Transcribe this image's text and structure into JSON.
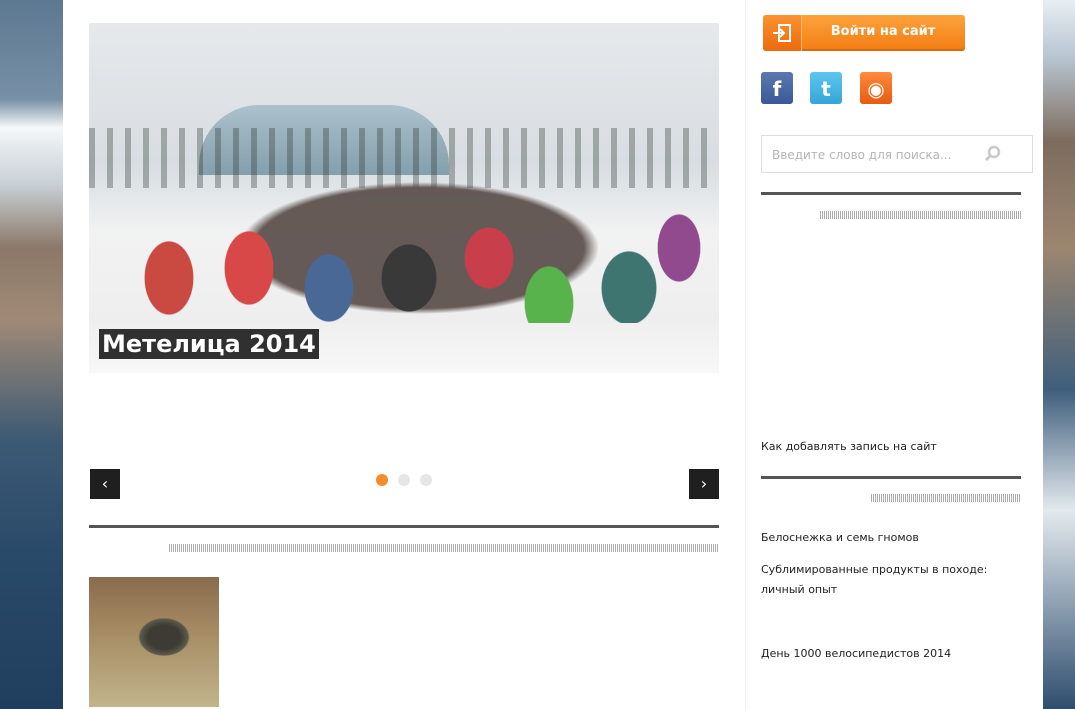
{
  "slider": {
    "caption": "Метелица 2014",
    "prev_symbol": "‹",
    "next_symbol": "›",
    "dots": [
      {
        "active": true
      },
      {
        "active": false
      },
      {
        "active": false
      }
    ]
  },
  "sidebar": {
    "login_label": "Войти на сайт",
    "social": {
      "facebook_glyph": "f",
      "twitter_glyph": "t",
      "rss_glyph": "◉"
    },
    "search": {
      "placeholder": "Введите слово для поиска..."
    },
    "links_group1": [
      "Как добавлять запись на сайт"
    ],
    "links_group2": [
      "Белоснежка и семь гномов",
      "Сублимированные продукты в походе:",
      "личный опыт",
      "День 1000 велосипедистов 2014"
    ]
  },
  "colors": {
    "accent": "#f58b2a",
    "dark": "#1f1f1f",
    "rule": "#555555"
  }
}
